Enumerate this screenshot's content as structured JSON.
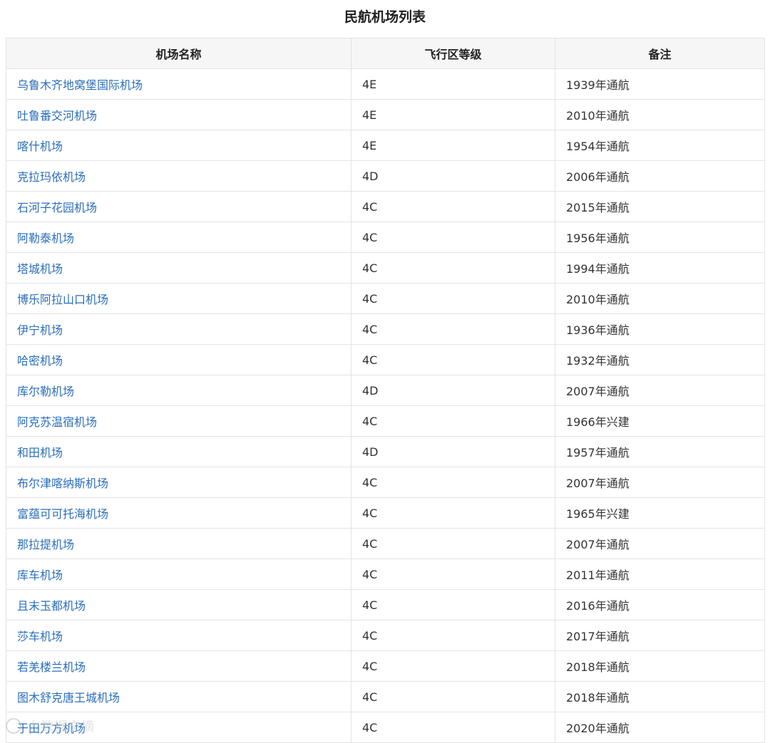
{
  "page": {
    "title": "民航机场列表"
  },
  "table": {
    "headers": [
      "机场名称",
      "飞行区等级",
      "备注"
    ],
    "rows": [
      [
        "乌鲁木齐地窝堡国际机场",
        "4E",
        "1939年通航"
      ],
      [
        "吐鲁番交河机场",
        "4E",
        "2010年通航"
      ],
      [
        "喀什机场",
        "4E",
        "1954年通航"
      ],
      [
        "克拉玛依机场",
        "4D",
        "2006年通航"
      ],
      [
        "石河子花园机场",
        "4C",
        "2015年通航"
      ],
      [
        "阿勒泰机场",
        "4C",
        "1956年通航"
      ],
      [
        "塔城机场",
        "4C",
        "1994年通航"
      ],
      [
        "博乐阿拉山口机场",
        "4C",
        "2010年通航"
      ],
      [
        "伊宁机场",
        "4C",
        "1936年通航"
      ],
      [
        "哈密机场",
        "4C",
        "1932年通航"
      ],
      [
        "库尔勒机场",
        "4D",
        "2007年通航"
      ],
      [
        "阿克苏温宿机场",
        "4C",
        "1966年兴建"
      ],
      [
        "和田机场",
        "4D",
        "1957年通航"
      ],
      [
        "布尔津喀纳斯机场",
        "4C",
        "2007年通航"
      ],
      [
        "富蕴可可托海机场",
        "4C",
        "1965年兴建"
      ],
      [
        "那拉提机场",
        "4C",
        "2007年通航"
      ],
      [
        "库车机场",
        "4C",
        "2011年通航"
      ],
      [
        "且末玉都机场",
        "4C",
        "2016年通航"
      ],
      [
        "莎车机场",
        "4C",
        "2017年通航"
      ],
      [
        "若羌楼兰机场",
        "4C",
        "2018年通航"
      ],
      [
        "图木舒克唐王城机场",
        "4C",
        "2018年通航"
      ],
      [
        "于田万方机场",
        "4C",
        "2020年通航"
      ]
    ]
  },
  "watermark": {
    "text": "大数据文摘",
    "icon": "watermark-logo-icon"
  },
  "colors": {
    "link": "#2a6ebb",
    "header_bg": "#f6f6f6",
    "border": "#e3e3e3"
  }
}
